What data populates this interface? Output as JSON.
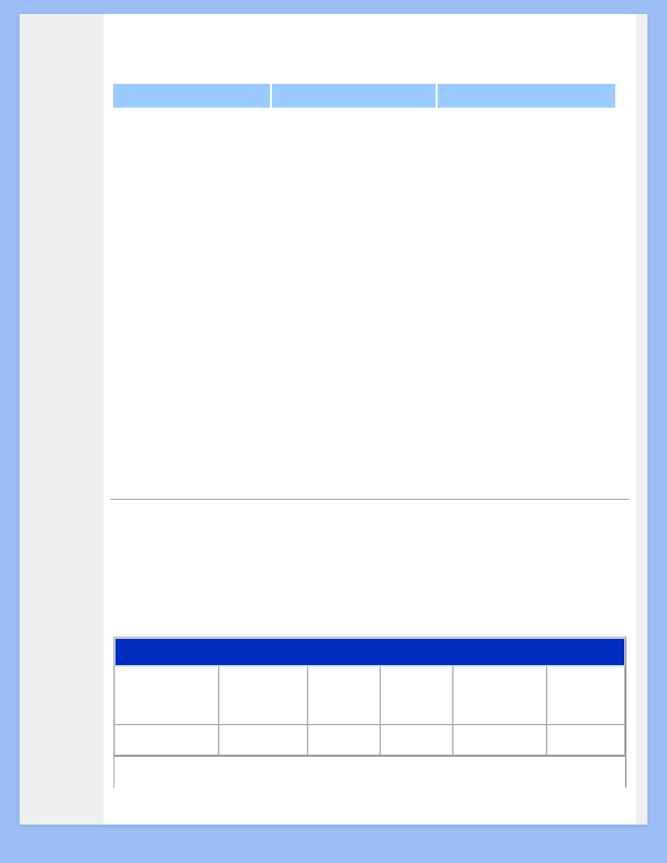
{
  "tabs": [
    {
      "label": ""
    },
    {
      "label": ""
    },
    {
      "label": ""
    }
  ],
  "table": {
    "header": "",
    "columns": [
      "",
      "",
      "",
      "",
      "",
      ""
    ],
    "rows": [
      [
        "",
        "",
        "",
        "",
        "",
        ""
      ],
      [
        "",
        "",
        "",
        "",
        "",
        ""
      ]
    ]
  }
}
